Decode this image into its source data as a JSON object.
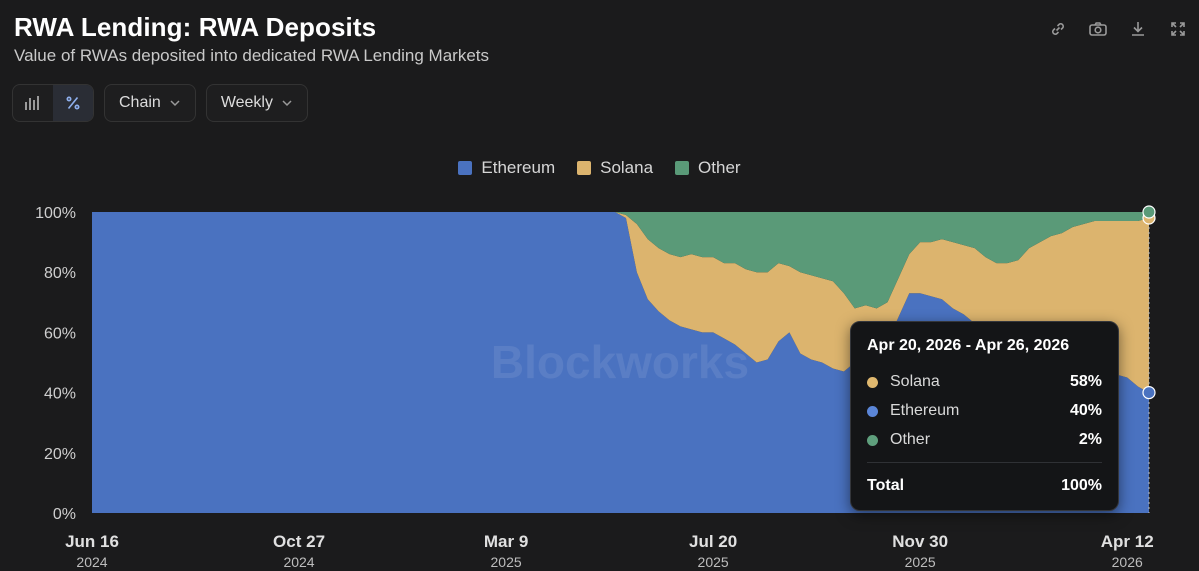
{
  "title": "RWA Lending: RWA Deposits",
  "subtitle": "Value of RWAs deposited into dedicated RWA Lending Markets",
  "toolbar": {
    "view_icons": [
      "bar-chart-icon",
      "percent-icon"
    ],
    "chain_label": "Chain",
    "interval_label": "Weekly"
  },
  "top_icons": [
    "link-icon",
    "camera-icon",
    "download-icon",
    "fullscreen-icon"
  ],
  "watermark": "Blockworks",
  "colors": {
    "Ethereum": "#4a72c0",
    "Solana": "#dcb46e",
    "Other": "#5a9a78",
    "background": "#1b1b1c"
  },
  "tooltip": {
    "title": "Apr 20, 2026 - Apr 26, 2026",
    "rows": [
      {
        "name": "Solana",
        "value": "58%",
        "color": "#e0b86f"
      },
      {
        "name": "Ethereum",
        "value": "40%",
        "color": "#5b86d8"
      },
      {
        "name": "Other",
        "value": "2%",
        "color": "#5f9f7d"
      }
    ],
    "total_label": "Total",
    "total_value": "100%"
  },
  "chart_data": {
    "type": "area",
    "stacked": true,
    "normalized": true,
    "legend": [
      "Ethereum",
      "Solana",
      "Other"
    ],
    "legend_position": "top-center",
    "yticks": [
      "0%",
      "20%",
      "40%",
      "60%",
      "80%",
      "100%"
    ],
    "ylim": [
      0,
      100
    ],
    "xlim": [
      "2024-06-16",
      "2026-04-26"
    ],
    "xticks": [
      {
        "date": "2024-06-16",
        "label": "Jun 16",
        "year": "2024"
      },
      {
        "date": "2024-10-27",
        "label": "Oct 27",
        "year": "2024"
      },
      {
        "date": "2025-03-09",
        "label": "Mar 9",
        "year": "2025"
      },
      {
        "date": "2025-07-20",
        "label": "Jul 20",
        "year": "2025"
      },
      {
        "date": "2025-11-30",
        "label": "Nov 30",
        "year": "2025"
      },
      {
        "date": "2026-04-12",
        "label": "Apr 12",
        "year": "2026"
      }
    ],
    "grid": false,
    "x": [
      "2024-06-16",
      "2025-05-18",
      "2025-05-25",
      "2025-06-01",
      "2025-06-08",
      "2025-06-15",
      "2025-06-22",
      "2025-06-29",
      "2025-07-06",
      "2025-07-13",
      "2025-07-20",
      "2025-07-27",
      "2025-08-03",
      "2025-08-10",
      "2025-08-17",
      "2025-08-24",
      "2025-08-31",
      "2025-09-07",
      "2025-09-14",
      "2025-09-21",
      "2025-09-28",
      "2025-10-05",
      "2025-10-12",
      "2025-10-19",
      "2025-10-26",
      "2025-11-02",
      "2025-11-09",
      "2025-11-16",
      "2025-11-23",
      "2025-11-30",
      "2025-12-07",
      "2025-12-14",
      "2025-12-21",
      "2025-12-28",
      "2026-01-04",
      "2026-01-11",
      "2026-01-18",
      "2026-01-25",
      "2026-02-01",
      "2026-02-08",
      "2026-02-15",
      "2026-02-22",
      "2026-03-01",
      "2026-03-08",
      "2026-03-15",
      "2026-03-22",
      "2026-03-29",
      "2026-04-05",
      "2026-04-12",
      "2026-04-19",
      "2026-04-26"
    ],
    "series": [
      {
        "name": "Ethereum",
        "values": [
          100,
          100,
          98,
          80,
          71,
          67,
          64,
          62,
          61,
          60,
          60,
          58,
          56,
          53,
          50,
          51,
          57,
          60,
          53,
          51,
          50,
          48,
          47,
          50,
          52,
          53,
          57,
          65,
          73,
          73,
          72,
          71,
          68,
          66,
          63,
          62,
          58,
          55,
          52,
          52,
          52,
          53,
          51,
          50,
          49,
          48,
          47,
          46,
          45,
          42,
          40
        ]
      },
      {
        "name": "Solana",
        "values": [
          0,
          0,
          1,
          16,
          20,
          21,
          22,
          23,
          25,
          25,
          25,
          25,
          27,
          28,
          30,
          29,
          26,
          22,
          27,
          28,
          28,
          29,
          26,
          18,
          17,
          15,
          13,
          13,
          13,
          17,
          18,
          20,
          22,
          23,
          25,
          23,
          25,
          28,
          32,
          36,
          38,
          39,
          42,
          45,
          47,
          49,
          50,
          51,
          52,
          55,
          58
        ]
      },
      {
        "name": "Other",
        "values": [
          0,
          0,
          1,
          4,
          9,
          12,
          14,
          15,
          14,
          15,
          15,
          17,
          17,
          19,
          20,
          20,
          17,
          18,
          20,
          21,
          22,
          23,
          27,
          32,
          31,
          32,
          30,
          22,
          14,
          10,
          10,
          9,
          10,
          11,
          12,
          15,
          17,
          17,
          16,
          12,
          10,
          8,
          7,
          5,
          4,
          3,
          3,
          3,
          3,
          3,
          2
        ]
      }
    ]
  }
}
